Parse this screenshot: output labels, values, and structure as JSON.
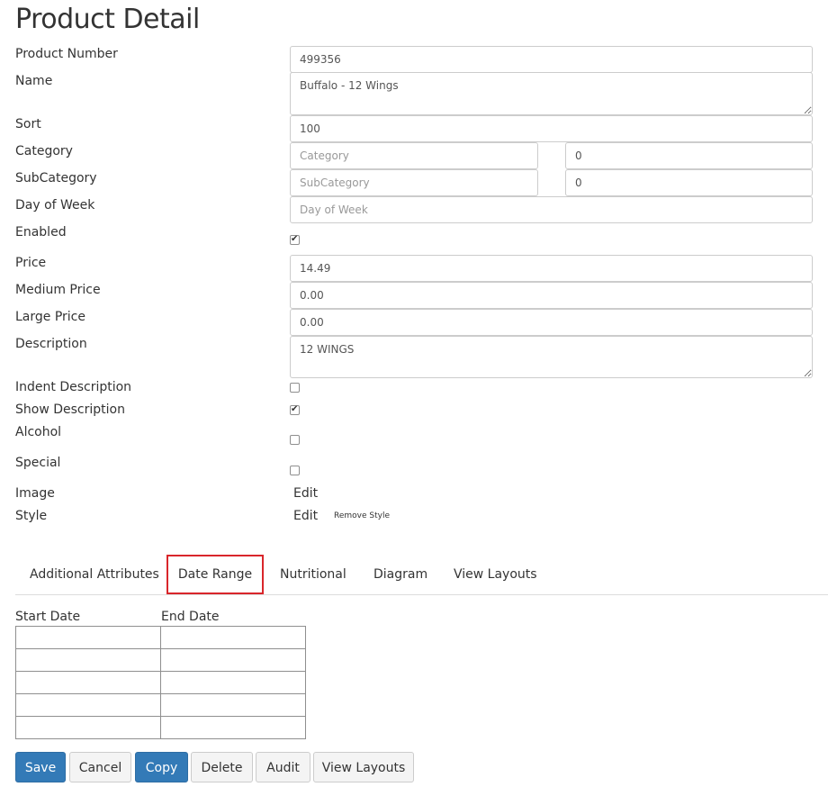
{
  "page": {
    "title": "Product Detail"
  },
  "fields": {
    "product_number": {
      "label": "Product Number",
      "value": "499356"
    },
    "name": {
      "label": "Name",
      "value": "Buffalo - 12 Wings"
    },
    "sort": {
      "label": "Sort",
      "value": "100"
    },
    "category": {
      "label": "Category",
      "placeholder": "Category",
      "value": "",
      "id_value": "0"
    },
    "subcategory": {
      "label": "SubCategory",
      "placeholder": "SubCategory",
      "value": "",
      "id_value": "0"
    },
    "day_of_week": {
      "label": "Day of Week",
      "placeholder": "Day of Week",
      "value": ""
    },
    "enabled": {
      "label": "Enabled",
      "checked": true
    },
    "price": {
      "label": "Price",
      "value": "14.49"
    },
    "medium_price": {
      "label": "Medium Price",
      "value": "0.00"
    },
    "large_price": {
      "label": "Large Price",
      "value": "0.00"
    },
    "description": {
      "label": "Description",
      "value": "12 WINGS"
    },
    "indent_description": {
      "label": "Indent Description",
      "checked": false
    },
    "show_description": {
      "label": "Show Description",
      "checked": true
    },
    "alcohol": {
      "label": "Alcohol",
      "checked": false
    },
    "special": {
      "label": "Special",
      "checked": false
    },
    "image": {
      "label": "Image",
      "edit_label": "Edit"
    },
    "style": {
      "label": "Style",
      "edit_label": "Edit",
      "remove_label": "Remove Style"
    }
  },
  "tabs": [
    {
      "label": "Additional Attributes",
      "active": false
    },
    {
      "label": "Date Range",
      "active": true
    },
    {
      "label": "Nutritional",
      "active": false
    },
    {
      "label": "Diagram",
      "active": false
    },
    {
      "label": "View Layouts",
      "active": false
    }
  ],
  "date_range": {
    "columns": [
      "Start Date",
      "End Date"
    ],
    "rows": [
      [
        "",
        ""
      ],
      [
        "",
        ""
      ],
      [
        "",
        ""
      ],
      [
        "",
        ""
      ],
      [
        "",
        ""
      ]
    ]
  },
  "buttons": {
    "save": "Save",
    "cancel": "Cancel",
    "copy": "Copy",
    "delete": "Delete",
    "audit": "Audit",
    "view_layouts": "View Layouts"
  },
  "colors": {
    "primary": "#337ab7",
    "active_tab_outline": "#d9262b"
  }
}
